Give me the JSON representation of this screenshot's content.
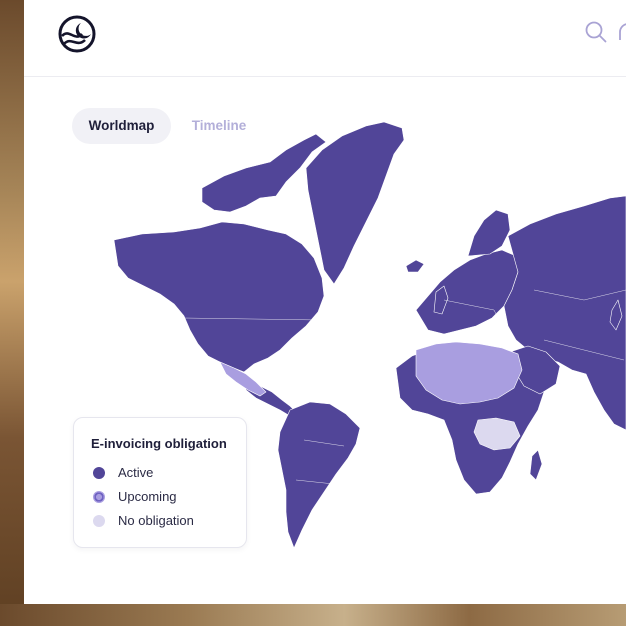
{
  "tabs": [
    {
      "label": "Worldmap",
      "active": true
    },
    {
      "label": "Timeline",
      "active": false
    }
  ],
  "header": {
    "logo_icon": "wave-globe-logo",
    "search_icon": "search-icon"
  },
  "legend": {
    "title": "E-invoicing obligation",
    "items": [
      {
        "label": "Active",
        "color": "#514598"
      },
      {
        "label": "Upcoming",
        "color": "#8a7dd6"
      },
      {
        "label": "No obligation",
        "color": "#dcd9ef"
      }
    ]
  },
  "colors": {
    "active": "#514598",
    "upcoming": "#a99ee0",
    "no_obligation": "#dcd9ef",
    "accent": "#1f1f3a",
    "muted_tab": "#b3afd9"
  }
}
